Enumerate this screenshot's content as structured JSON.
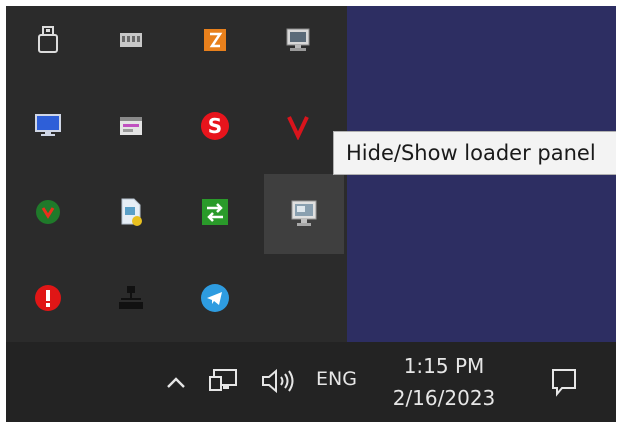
{
  "tooltip": {
    "text": "Hide/Show loader panel"
  },
  "tray": {
    "icons": [
      {
        "name": "usb-drive-icon"
      },
      {
        "name": "memory-card-icon"
      },
      {
        "name": "orange-app-icon"
      },
      {
        "name": "network-monitor-icon"
      },
      {
        "name": "display-icon"
      },
      {
        "name": "window-app-icon"
      },
      {
        "name": "red-s-app-icon"
      },
      {
        "name": "red-v-app-icon"
      },
      {
        "name": "green-shield-icon"
      },
      {
        "name": "document-settings-icon"
      },
      {
        "name": "green-sync-icon"
      },
      {
        "name": "loader-panel-icon"
      },
      {
        "name": "red-alert-icon"
      },
      {
        "name": "network-tree-icon"
      },
      {
        "name": "telegram-icon"
      }
    ],
    "active_icon": "loader-panel-icon"
  },
  "taskbar": {
    "language": "ENG",
    "time": "1:15 PM",
    "date": "2/16/2023",
    "show_hidden_icons": "chevron-up-icon",
    "network": "network-icon",
    "volume": "volume-icon",
    "notifications": "notification-icon"
  },
  "colors": {
    "desktop": "#2d2e62",
    "tray_panel": "#2b2b2b",
    "taskbar": "#232323",
    "tooltip_bg": "#f3f3f3"
  }
}
